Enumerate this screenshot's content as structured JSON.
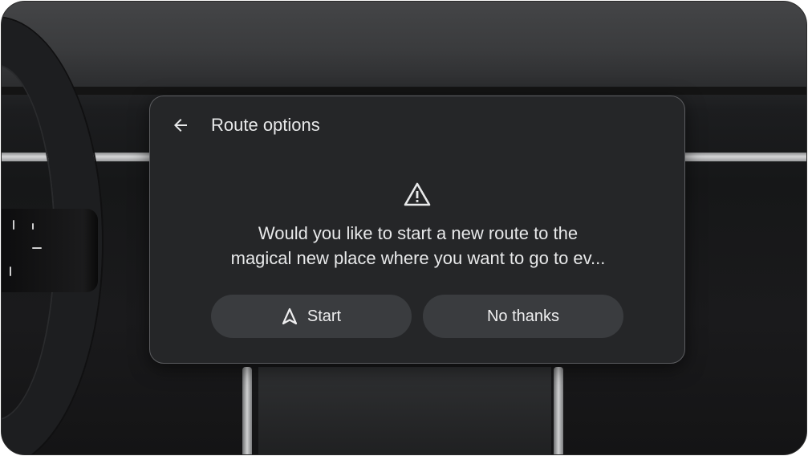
{
  "dialog": {
    "title": "Route options",
    "message_line1": "Would you like to start a new route to the",
    "message_line2": "magical new place where you want to go to ev...",
    "start_label": "Start",
    "no_thanks_label": "No thanks"
  },
  "icons": {
    "back": "arrow-back-icon",
    "warning": "warning-icon",
    "navigation": "navigation-arrow-icon"
  },
  "colors": {
    "card_background": "#252628",
    "button_background": "#3a3c3f",
    "text": "#e8e9ea"
  }
}
